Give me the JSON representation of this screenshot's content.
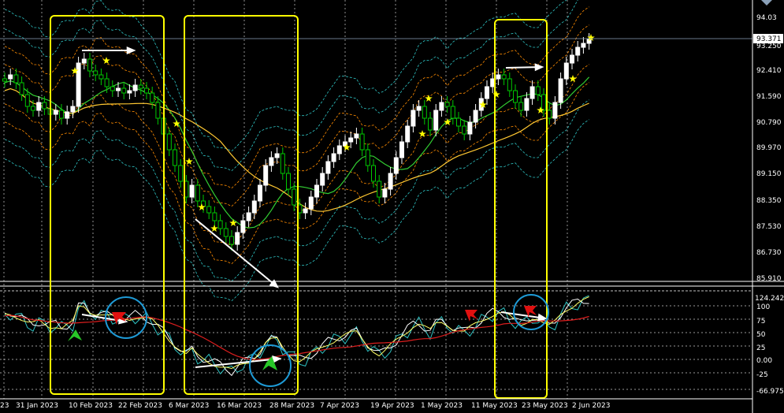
{
  "price_axis": {
    "ticks": [
      "94.03",
      "93.250",
      "92.410",
      "91.590",
      "90.790",
      "89.970",
      "89.150",
      "88.350",
      "87.530",
      "86.730",
      "85.910"
    ],
    "current_price": "93.371"
  },
  "oscillator_axis": {
    "ticks": [
      "124.242",
      "100",
      "75",
      "50",
      "25",
      "0.00",
      "-25",
      "-66.9755"
    ]
  },
  "time_axis": {
    "labels": [
      "23",
      "31 Jan 2023",
      "10 Feb 2023",
      "22 Feb 2023",
      "6 Mar 2023",
      "16 Mar 2023",
      "28 Mar 2023",
      "7 Apr 2023",
      "19 Apr 2023",
      "1 May 2023",
      "11 May 2023",
      "23 May 2023",
      "2 Jun 2023"
    ]
  },
  "colors": {
    "background": "#000000",
    "bull_candle": "#ffffff",
    "bear_candle": "#00c800",
    "grid": "#ffffff",
    "highlight_box": "#ffff00",
    "circle": "#1e9bd7",
    "ma_fast": "#32cd32",
    "ma_slow": "#ffc832",
    "band_inner": "#ff8c00",
    "band_outer": "#2ec4c4",
    "star": "#ffff00",
    "signal_line": "#dc1e1e"
  },
  "icons": [
    "star-marker-icon",
    "red-arrow-icon",
    "green-arrow-icon",
    "white-trend-arrow-icon"
  ]
}
